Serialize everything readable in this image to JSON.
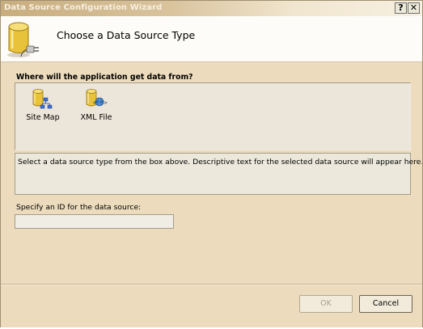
{
  "window": {
    "title": "Data Source Configuration Wizard",
    "help_label": "?",
    "close_label": "✕"
  },
  "header": {
    "title": "Choose a Data Source Type",
    "icon": "database-plug-icon"
  },
  "main": {
    "question": "Where will the application get data from?",
    "sources": [
      {
        "label": "Site Map",
        "icon": "site-map-icon"
      },
      {
        "label": "XML File",
        "icon": "xml-file-icon"
      }
    ],
    "description": "Select a data source type from the box above. Descriptive text for the selected data source will appear here.",
    "id_label": "Specify an ID for the data source:",
    "id_value": ""
  },
  "buttons": {
    "ok_label": "OK",
    "cancel_label": "Cancel"
  },
  "colors": {
    "background": "#ecdcbd",
    "header_background": "#fdfcf9",
    "titlebar_text": "#f7efe0",
    "db_yellow": "#e8c23a"
  }
}
